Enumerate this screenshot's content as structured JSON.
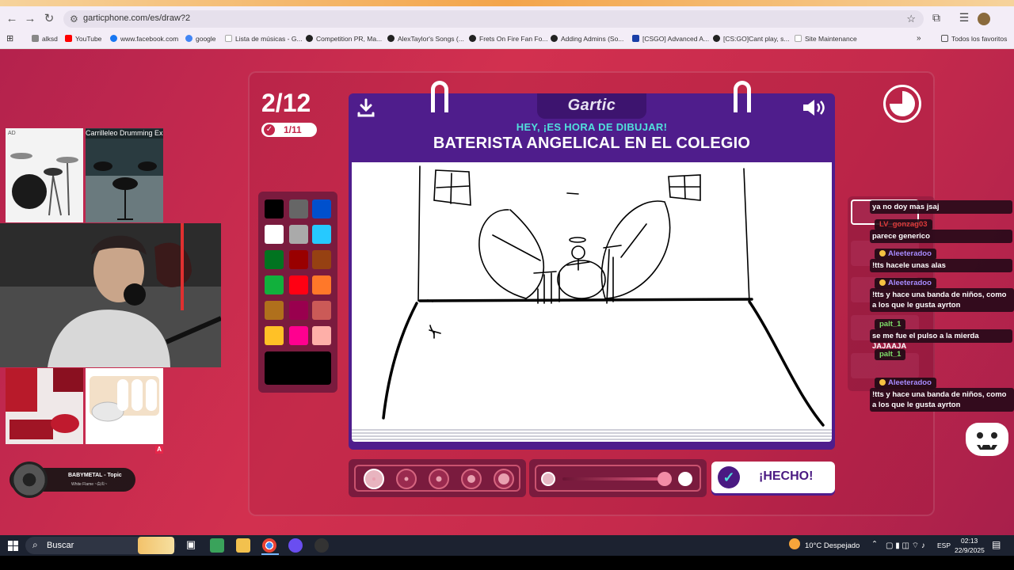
{
  "browser": {
    "url": "garticphone.com/es/draw?2",
    "bookmarks": [
      "alksd",
      "YouTube",
      "www.facebook.com",
      "google",
      "Lista de músicas - G...",
      "Competition PR, Ma...",
      "AlexTaylor's Songs (...",
      "Frets On Fire Fan Fo...",
      "Adding Admins (So...",
      "[CSGO] Advanced A...",
      "[CS:GO]Cant play, s...",
      "Site Maintenance"
    ],
    "all_bookmarks": "Todos los favoritos"
  },
  "game": {
    "round": "2/12",
    "done_count": "1/11",
    "logo": "Gartic",
    "instruction": "HEY, ¡ES HORA DE DIBUJAR!",
    "prompt": "BATERISTA ANGELICAL EN EL COLEGIO",
    "done_label": "¡HECHO!",
    "timer_remaining": 0.75,
    "palette_colors": [
      "#000000",
      "#666666",
      "#0050cd",
      "#ffffff",
      "#aaaaaa",
      "#26c9ff",
      "#017420",
      "#990000",
      "#964112",
      "#11b03c",
      "#ff0013",
      "#ff7829",
      "#b0701c",
      "#99004e",
      "#cb5a57",
      "#ffc126",
      "#ff008f",
      "#feafa8"
    ],
    "current_color": "#000000",
    "brush_sizes": 5,
    "active_brush_size": 1
  },
  "overlay": {
    "ad_label": "AD",
    "video_title": "Carrilleleo Drumming Experie",
    "music_artist": "BABYMETAL - Topic",
    "music_song": "White Flame ~白炎~",
    "a_badge": "A"
  },
  "chat": [
    {
      "name": "",
      "msg": "ya no doy mas jsaj"
    },
    {
      "name": "LV_gonzag03",
      "name_color": "#e03a3a",
      "msg": "parece generico"
    },
    {
      "name": "Aleeteradoo",
      "name_color": "#a78bff",
      "msg": "!tts hacele unas alas"
    },
    {
      "name": "Aleeteradoo",
      "name_color": "#a78bff",
      "msg": "!tts y hace una banda de niños, como a los que le gusta ayrton"
    },
    {
      "name": "palt_1",
      "name_color": "#7ee06a",
      "msg": "se me fue el pulso a la mierda JAJAAJA"
    },
    {
      "name": "palt_1",
      "name_color": "#7ee06a",
      "msg": ""
    },
    {
      "name": "Aleeteradoo",
      "name_color": "#a78bff",
      "msg": "!tts y hace una banda de niños, como a los que le gusta ayrton"
    }
  ],
  "taskbar": {
    "search": "Buscar",
    "weather": "10°C  Despejado",
    "lang": "ESP",
    "time": "02:13",
    "date": "22/9/2025"
  }
}
